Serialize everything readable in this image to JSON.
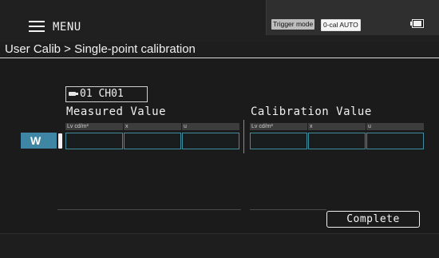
{
  "header": {
    "menu_label": "MENU",
    "trigger_mode_label": "Trigger mode",
    "ocal_label": "0-cal AUTO",
    "icons": {
      "menu": "hamburger-icon",
      "battery": "battery-icon",
      "probe": "probe-icon"
    }
  },
  "breadcrumb": "User Calib > Single-point calibration",
  "probe": {
    "label": "01 CH01"
  },
  "measured": {
    "title": "Measured Value",
    "columns": [
      "Lv     cd/m²",
      "x",
      "u"
    ],
    "values": [
      "",
      "",
      ""
    ]
  },
  "calibration": {
    "title": "Calibration Value",
    "columns": [
      "Lv     cd/m²",
      "x",
      "u"
    ],
    "values": [
      "",
      "",
      ""
    ]
  },
  "row": {
    "label": "W"
  },
  "buttons": {
    "complete": "Complete"
  },
  "colors": {
    "accent": "#3f86a5",
    "cell_border": "#3f8fa0",
    "background": "#1b1b1b"
  }
}
